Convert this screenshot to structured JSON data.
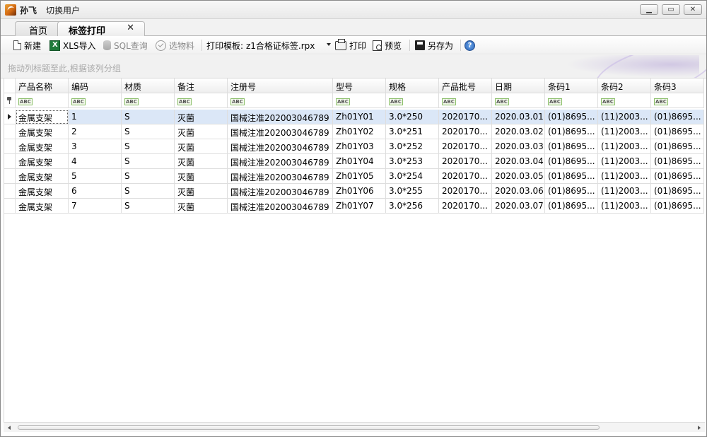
{
  "titlebar": {
    "user": "孙飞",
    "switch_user": "切换用户"
  },
  "tabs": [
    {
      "label": "首页",
      "active": false
    },
    {
      "label": "标签打印",
      "active": true,
      "close": "✕"
    }
  ],
  "toolbar": {
    "new": "新建",
    "xls_import": "XLS导入",
    "sql_query": "SQL查询",
    "select_material": "选物料",
    "template_label": "打印模板:",
    "template_value": "z1合格证标签.rpx",
    "print": "打印",
    "preview": "预览",
    "save_as": "另存为",
    "help": "?"
  },
  "group_panel": {
    "text": "拖动列标题至此,根据该列分组"
  },
  "grid": {
    "filter_glyph": "ABC",
    "columns": [
      "产品名称",
      "编码",
      "材质",
      "备注",
      "注册号",
      "型号",
      "规格",
      "产品批号",
      "日期",
      "条码1",
      "条码2",
      "条码3"
    ],
    "rows": [
      [
        "金属支架",
        "1",
        "S",
        "灭菌",
        "国械注准202003046789",
        "Zh01Y01",
        "3.0*250",
        "2020170...",
        "2020.03.01",
        "(01)8695...",
        "(11)2003...",
        "(01)8695..."
      ],
      [
        "金属支架",
        "2",
        "S",
        "灭菌",
        "国械注准202003046789",
        "Zh01Y02",
        "3.0*251",
        "2020170...",
        "2020.03.02",
        "(01)8695...",
        "(11)2003...",
        "(01)8695..."
      ],
      [
        "金属支架",
        "3",
        "S",
        "灭菌",
        "国械注准202003046789",
        "Zh01Y03",
        "3.0*252",
        "2020170...",
        "2020.03.03",
        "(01)8695...",
        "(11)2003...",
        "(01)8695..."
      ],
      [
        "金属支架",
        "4",
        "S",
        "灭菌",
        "国械注准202003046789",
        "Zh01Y04",
        "3.0*253",
        "2020170...",
        "2020.03.04",
        "(01)8695...",
        "(11)2003...",
        "(01)8695..."
      ],
      [
        "金属支架",
        "5",
        "S",
        "灭菌",
        "国械注准202003046789",
        "Zh01Y05",
        "3.0*254",
        "2020170...",
        "2020.03.05",
        "(01)8695...",
        "(11)2003...",
        "(01)8695..."
      ],
      [
        "金属支架",
        "6",
        "S",
        "灭菌",
        "国械注准202003046789",
        "Zh01Y06",
        "3.0*255",
        "2020170...",
        "2020.03.06",
        "(01)8695...",
        "(11)2003...",
        "(01)8695..."
      ],
      [
        "金属支架",
        "7",
        "S",
        "灭菌",
        "国械注准202003046789",
        "Zh01Y07",
        "3.0*256",
        "2020170...",
        "2020.03.07",
        "(01)8695...",
        "(11)2003...",
        "(01)8695..."
      ]
    ]
  }
}
